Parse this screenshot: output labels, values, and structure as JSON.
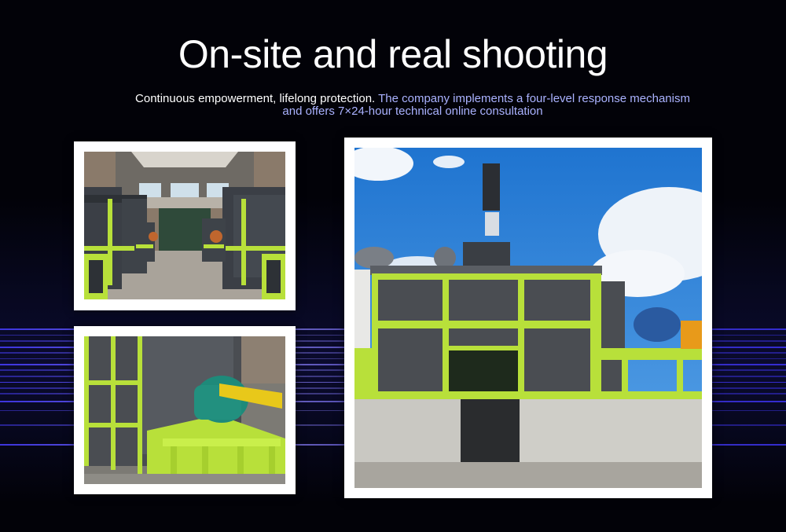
{
  "header": {
    "title": "On-site and real shooting",
    "subtitle_part1": "Continuous empowerment, lifelong protection. ",
    "subtitle_part2": "The company implements a four-level response mechanism and offers 7×24-hour technical online consultation"
  },
  "colors": {
    "background": "#020208",
    "highlight_text": "#aab2ff",
    "machine_green": "#b8e03a",
    "machine_panel": "#4a4d52",
    "sky_blue": "#2a7fd6",
    "streak_blue": "#5b4dff"
  }
}
